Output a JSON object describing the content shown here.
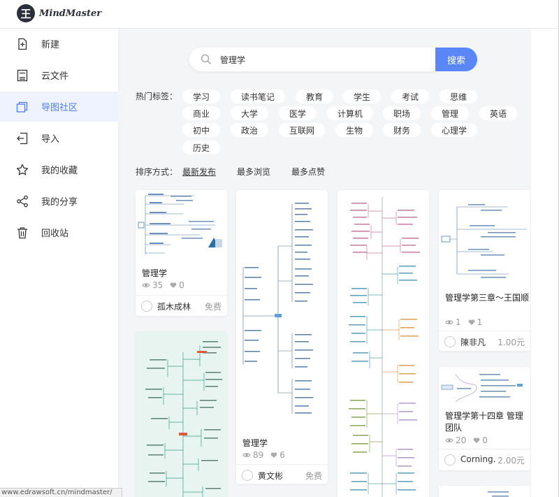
{
  "app": {
    "logo_mark": "王",
    "logo_text": "MindMaster"
  },
  "sidebar": {
    "items": [
      {
        "label": "新建",
        "icon": "new-file-icon"
      },
      {
        "label": "云文件",
        "icon": "cloud-file-icon"
      },
      {
        "label": "导图社区",
        "icon": "community-icon",
        "active": true
      },
      {
        "label": "导入",
        "icon": "import-icon"
      },
      {
        "label": "我的收藏",
        "icon": "star-icon"
      },
      {
        "label": "我的分享",
        "icon": "share-icon"
      },
      {
        "label": "回收站",
        "icon": "trash-icon"
      }
    ]
  },
  "search": {
    "value": "管理学",
    "button_label": "搜索"
  },
  "tags": {
    "label": "热门标签：",
    "items": [
      "学习",
      "读书笔记",
      "教育",
      "学生",
      "考试",
      "思维",
      "商业",
      "大学",
      "医学",
      "计算机",
      "职场",
      "管理",
      "英语",
      "初中",
      "政治",
      "互联网",
      "生物",
      "财务",
      "心理学",
      "历史"
    ]
  },
  "sort": {
    "label": "排序方式：",
    "options": [
      "最新发布",
      "最多浏览",
      "最多点赞"
    ],
    "active": "最新发布"
  },
  "cards": [
    {
      "title": "管理学",
      "views": "35",
      "likes": "0",
      "author": "孤木成林",
      "price": "免费"
    },
    {
      "title": "管理学",
      "views": "89",
      "likes": "6",
      "author": "黄文彬",
      "price": "免费"
    },
    {
      "title": "管理学第三章～王国顺",
      "views": "1",
      "likes": "1",
      "author": "陳非凡",
      "price": "1.00元"
    },
    {
      "title": "管理学第十四章 管理团队",
      "views": "20",
      "likes": "0",
      "author": "Corning.",
      "price": "2.00元"
    }
  ],
  "status_url": "www.edrawsoft.cn/mindmaster/",
  "colors": {
    "accent": "#5b86f7",
    "active_bg": "#eef3ff",
    "active_text": "#4e7cf6",
    "page_bg": "#f4f5f7"
  }
}
